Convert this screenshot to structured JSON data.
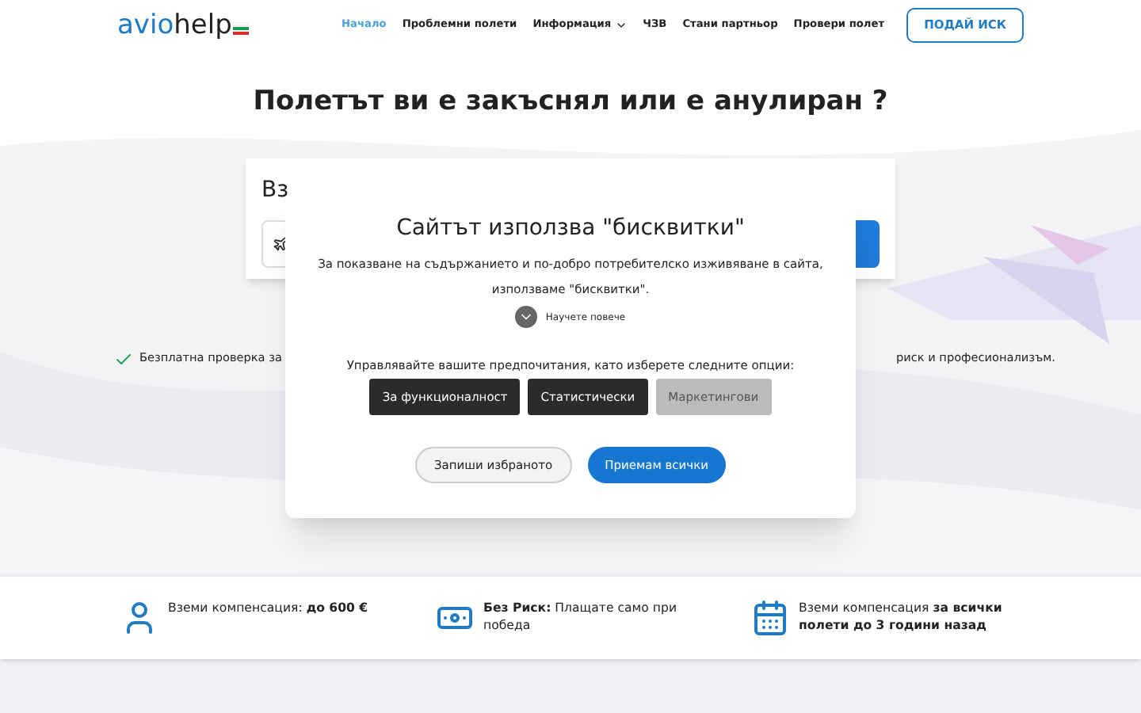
{
  "header": {
    "logo": {
      "part1": "avio",
      "part2": "help"
    },
    "nav": [
      {
        "label": "Начало",
        "selected": true,
        "dropdown": false
      },
      {
        "label": "Проблемни полети",
        "selected": false,
        "dropdown": false
      },
      {
        "label": "Информация",
        "selected": false,
        "dropdown": true
      },
      {
        "label": "ЧЗВ",
        "selected": false,
        "dropdown": false
      },
      {
        "label": "Стани партньор",
        "selected": false,
        "dropdown": false
      },
      {
        "label": "Провери полет",
        "selected": false,
        "dropdown": false
      }
    ],
    "cta": "ПОДАЙ ИСК"
  },
  "hero": {
    "title": "Полетът ви е закъснял или е анулиран ?",
    "card_title": "Вз",
    "features": [
      "Безплатна проверка за",
      "риск и професионализъм."
    ]
  },
  "cookie_dialog": {
    "title": "Сайтът използва \"бисквитки\"",
    "text": "За показване на съдържанието и по-добро потребителско изживяване в сайта, използваме \"бисквитки\".",
    "learn_more": "Научете повече",
    "prompt": "Управлявайте вашите предпочитания, като изберете следните опции:",
    "options": [
      {
        "label": "За функционалност",
        "selected": true
      },
      {
        "label": "Статистически",
        "selected": true
      },
      {
        "label": "Маркетингови",
        "selected": false
      }
    ],
    "buttons": [
      {
        "label": "Запиши избраното",
        "kind": "secondary"
      },
      {
        "label": "Приемам всички",
        "kind": "primary"
      }
    ]
  },
  "benefits": [
    {
      "kind": "person",
      "text": "Вземи компенсация: **до 600 €**"
    },
    {
      "kind": "money",
      "text": "**Без Риск:** Плащате само при победа"
    },
    {
      "kind": "calendar",
      "text": "Вземи компенсация **за всички полети до 3 години назад**"
    }
  ]
}
